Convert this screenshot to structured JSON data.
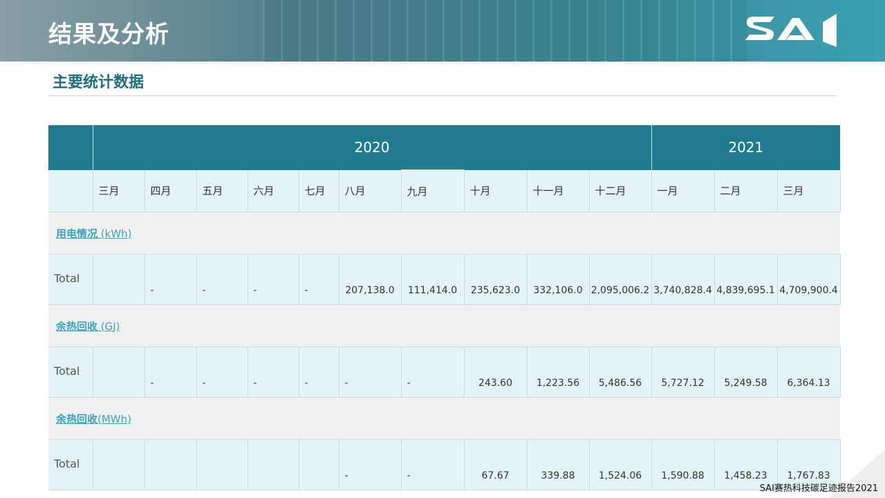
{
  "header": {
    "title": "结果及分析",
    "logo_text": "SAI"
  },
  "section_title": "主要统计数据",
  "table": {
    "years": [
      "2020",
      "2021"
    ],
    "months": [
      "三月",
      "四月",
      "五月",
      "六月",
      "七月",
      "八月",
      "九月",
      "十月",
      "十一月",
      "十二月",
      "一月",
      "二月",
      "三月"
    ],
    "sections": [
      {
        "label": "用电情况",
        "unit": " (kWh)",
        "row_label": "Total",
        "values": [
          "",
          "-",
          "-",
          "-",
          "-",
          "207,138.0",
          "111,414.0",
          "235,623.0",
          "332,106.0",
          "2,095,006.2",
          "3,740,828.4",
          "4,839,695.1",
          "4,709,900.4"
        ]
      },
      {
        "label": "余热回收",
        "unit": " (GJ)",
        "row_label": "Total",
        "values": [
          "",
          "-",
          "-",
          "-",
          "-",
          "-",
          "-",
          "243.60",
          "1,223.56",
          "5,486.56",
          "5,727.12",
          "5,249.58",
          "6,364.13"
        ]
      },
      {
        "label": "余热回收",
        "unit": "(MWh)",
        "row_label": "Total",
        "values": [
          "",
          "",
          "",
          "",
          "",
          "-",
          "-",
          "67.67",
          "339.88",
          "1,524.06",
          "1,590.88",
          "1,458.23",
          "1,767.83"
        ]
      }
    ]
  },
  "footer": "SAI赛热科技碳足迹报告2021",
  "colors": {
    "header_teal": "#217b8f",
    "light_row": "#e3f3f6",
    "section_bg": "#f1f1f1",
    "link": "#3aa2bb",
    "subtitle": "#1f6d80"
  }
}
